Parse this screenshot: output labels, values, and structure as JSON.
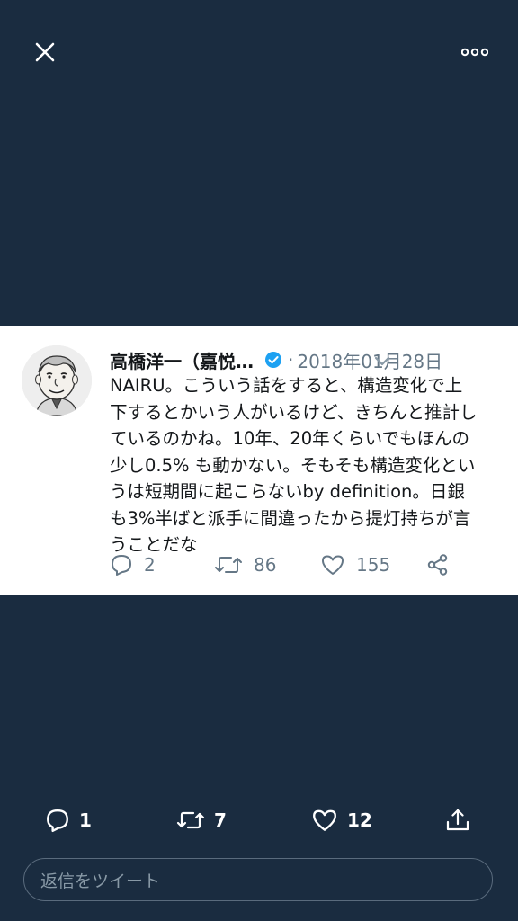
{
  "tweet": {
    "author_name": "高橋洋一（嘉悦…",
    "separator": "·",
    "date": "2018年01月28日",
    "text": "NAIRU。こういう話をすると、構造変化で上\n下するとかいう人がいるけど、きちんと推計し\nているのかね。10年、20年くらいでもほんの\n少し0.5% も動かない。そもそも構造変化とい\nうは短期間に起こらないby definition。日銀\nも3%半ばと派手に間違ったから提灯持ちが言\nうことだな",
    "reply_count": "2",
    "retweet_count": "86",
    "like_count": "155"
  },
  "footer": {
    "reply_count": "1",
    "retweet_count": "7",
    "like_count": "12"
  },
  "reply_box": {
    "placeholder": "返信をツイート"
  },
  "colors": {
    "background": "#1a2c40",
    "card": "#ffffff",
    "verified": "#1da1f2",
    "muted": "#657786"
  },
  "icons": [
    "close-icon",
    "more-icon",
    "verified-icon",
    "chevron-down-icon",
    "reply-icon",
    "retweet-icon",
    "like-icon",
    "share-icon"
  ]
}
